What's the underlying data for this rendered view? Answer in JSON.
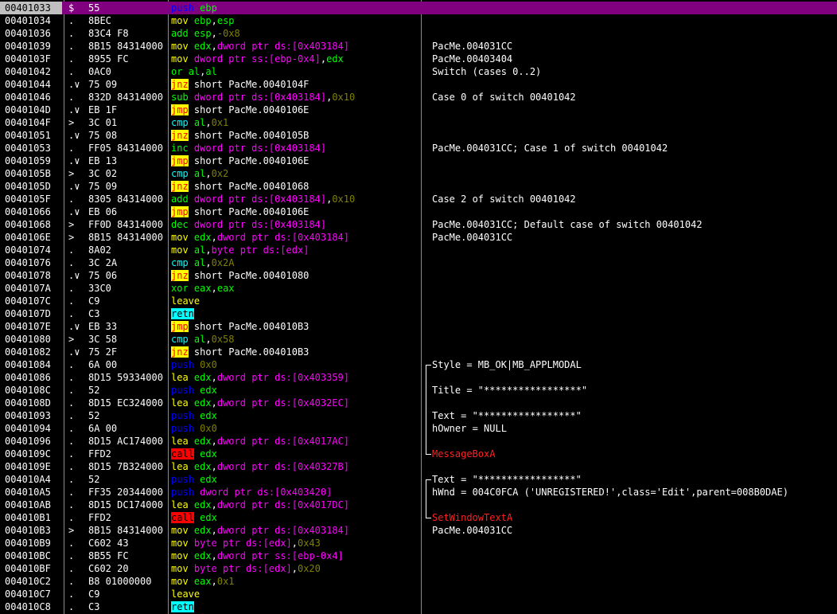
{
  "colors": {
    "background": "#000000",
    "selected_row": "#800080",
    "push_mnemonic": "#0000ff",
    "call_highlight": "#ff0000",
    "jump_highlight": "#ffff00",
    "ret_highlight": "#00ffff",
    "register": "#00ff00",
    "memory_operand": "#ff00ff",
    "immediate": "#808000",
    "api_name": "#ff2020"
  },
  "rows": [
    {
      "addr": "00401033",
      "mark": "$",
      "hex": "55",
      "asm": [
        {
          "t": "push",
          "c": "k-push"
        },
        {
          "t": " "
        },
        {
          "t": "ebp",
          "c": "o-reg"
        }
      ],
      "cmt": "",
      "selected": true
    },
    {
      "addr": "00401034",
      "mark": ".",
      "hex": "8BEC",
      "asm": [
        {
          "t": "mov",
          "c": "k-mov"
        },
        {
          "t": " "
        },
        {
          "t": "ebp",
          "c": "o-reg"
        },
        {
          "t": ","
        },
        {
          "t": "esp",
          "c": "o-reg"
        }
      ],
      "cmt": ""
    },
    {
      "addr": "00401036",
      "mark": ".",
      "hex": "83C4 F8",
      "asm": [
        {
          "t": "add",
          "c": "k-arith"
        },
        {
          "t": " "
        },
        {
          "t": "esp",
          "c": "o-reg"
        },
        {
          "t": ","
        },
        {
          "t": "-0x8",
          "c": "o-imm"
        }
      ],
      "cmt": ""
    },
    {
      "addr": "00401039",
      "mark": ".",
      "hex": "8B15 84314000",
      "asm": [
        {
          "t": "mov",
          "c": "k-mov"
        },
        {
          "t": " "
        },
        {
          "t": "edx",
          "c": "o-reg"
        },
        {
          "t": ","
        },
        {
          "t": "dword ptr ds:[0x403184]",
          "c": "o-mem"
        }
      ],
      "cmt": "PacMe.004031CC"
    },
    {
      "addr": "0040103F",
      "mark": ".",
      "hex": "8955 FC",
      "asm": [
        {
          "t": "mov",
          "c": "k-mov"
        },
        {
          "t": " "
        },
        {
          "t": "dword ptr ss:[ebp-0x4]",
          "c": "o-mem"
        },
        {
          "t": ","
        },
        {
          "t": "edx",
          "c": "o-reg"
        }
      ],
      "cmt": "PacMe.00403404"
    },
    {
      "addr": "00401042",
      "mark": ".",
      "hex": "0AC0",
      "asm": [
        {
          "t": "or",
          "c": "k-logic"
        },
        {
          "t": " "
        },
        {
          "t": "al",
          "c": "o-reg"
        },
        {
          "t": ","
        },
        {
          "t": "al",
          "c": "o-reg"
        }
      ],
      "cmt": "Switch (cases 0..2)"
    },
    {
      "addr": "00401044",
      "mark": ".∨",
      "hex": "75 09",
      "asm": [
        {
          "t": "jnz",
          "c": "k-jmp"
        },
        {
          "t": " short PacMe.0040104F",
          "c": "o-lbl"
        }
      ],
      "cmt": ""
    },
    {
      "addr": "00401046",
      "mark": ".",
      "hex": "832D 84314000",
      "asm": [
        {
          "t": "sub",
          "c": "k-arith"
        },
        {
          "t": " "
        },
        {
          "t": "dword ptr ds:[0x403184]",
          "c": "o-mem"
        },
        {
          "t": ","
        },
        {
          "t": "0x10",
          "c": "o-imm"
        }
      ],
      "cmt": "Case 0 of switch 00401042"
    },
    {
      "addr": "0040104D",
      "mark": ".∨",
      "hex": "EB 1F",
      "asm": [
        {
          "t": "jmp",
          "c": "k-jmp"
        },
        {
          "t": " short PacMe.0040106E",
          "c": "o-lbl"
        }
      ],
      "cmt": ""
    },
    {
      "addr": "0040104F",
      "mark": ">",
      "hex": "3C 01",
      "asm": [
        {
          "t": "cmp",
          "c": "k-cmp"
        },
        {
          "t": " "
        },
        {
          "t": "al",
          "c": "o-reg"
        },
        {
          "t": ","
        },
        {
          "t": "0x1",
          "c": "o-imm"
        }
      ],
      "cmt": ""
    },
    {
      "addr": "00401051",
      "mark": ".∨",
      "hex": "75 08",
      "asm": [
        {
          "t": "jnz",
          "c": "k-jmp"
        },
        {
          "t": " short PacMe.0040105B",
          "c": "o-lbl"
        }
      ],
      "cmt": ""
    },
    {
      "addr": "00401053",
      "mark": ".",
      "hex": "FF05 84314000",
      "asm": [
        {
          "t": "inc",
          "c": "k-arith"
        },
        {
          "t": " "
        },
        {
          "t": "dword ptr ds:[0x403184]",
          "c": "o-mem"
        }
      ],
      "cmt": "PacMe.004031CC; Case 1 of switch 00401042"
    },
    {
      "addr": "00401059",
      "mark": ".∨",
      "hex": "EB 13",
      "asm": [
        {
          "t": "jmp",
          "c": "k-jmp"
        },
        {
          "t": " short PacMe.0040106E",
          "c": "o-lbl"
        }
      ],
      "cmt": ""
    },
    {
      "addr": "0040105B",
      "mark": ">",
      "hex": "3C 02",
      "asm": [
        {
          "t": "cmp",
          "c": "k-cmp"
        },
        {
          "t": " "
        },
        {
          "t": "al",
          "c": "o-reg"
        },
        {
          "t": ","
        },
        {
          "t": "0x2",
          "c": "o-imm"
        }
      ],
      "cmt": ""
    },
    {
      "addr": "0040105D",
      "mark": ".∨",
      "hex": "75 09",
      "asm": [
        {
          "t": "jnz",
          "c": "k-jmp"
        },
        {
          "t": " short PacMe.00401068",
          "c": "o-lbl"
        }
      ],
      "cmt": ""
    },
    {
      "addr": "0040105F",
      "mark": ".",
      "hex": "8305 84314000",
      "asm": [
        {
          "t": "add",
          "c": "k-arith"
        },
        {
          "t": " "
        },
        {
          "t": "dword ptr ds:[0x403184]",
          "c": "o-mem"
        },
        {
          "t": ","
        },
        {
          "t": "0x10",
          "c": "o-imm"
        }
      ],
      "cmt": "Case 2 of switch 00401042"
    },
    {
      "addr": "00401066",
      "mark": ".∨",
      "hex": "EB 06",
      "asm": [
        {
          "t": "jmp",
          "c": "k-jmp"
        },
        {
          "t": " short PacMe.0040106E",
          "c": "o-lbl"
        }
      ],
      "cmt": ""
    },
    {
      "addr": "00401068",
      "mark": ">",
      "hex": "FF0D 84314000",
      "asm": [
        {
          "t": "dec",
          "c": "k-arith"
        },
        {
          "t": " "
        },
        {
          "t": "dword ptr ds:[0x403184]",
          "c": "o-mem"
        }
      ],
      "cmt": "PacMe.004031CC; Default case of switch 00401042"
    },
    {
      "addr": "0040106E",
      "mark": ">",
      "hex": "8B15 84314000",
      "asm": [
        {
          "t": "mov",
          "c": "k-mov"
        },
        {
          "t": " "
        },
        {
          "t": "edx",
          "c": "o-reg"
        },
        {
          "t": ","
        },
        {
          "t": "dword ptr ds:[0x403184]",
          "c": "o-mem"
        }
      ],
      "cmt": "PacMe.004031CC"
    },
    {
      "addr": "00401074",
      "mark": ".",
      "hex": "8A02",
      "asm": [
        {
          "t": "mov",
          "c": "k-mov"
        },
        {
          "t": " "
        },
        {
          "t": "al",
          "c": "o-reg"
        },
        {
          "t": ","
        },
        {
          "t": "byte ptr ds:[edx]",
          "c": "o-mem"
        }
      ],
      "cmt": ""
    },
    {
      "addr": "00401076",
      "mark": ".",
      "hex": "3C 2A",
      "asm": [
        {
          "t": "cmp",
          "c": "k-cmp"
        },
        {
          "t": " "
        },
        {
          "t": "al",
          "c": "o-reg"
        },
        {
          "t": ","
        },
        {
          "t": "0x2A",
          "c": "o-imm"
        }
      ],
      "cmt": ""
    },
    {
      "addr": "00401078",
      "mark": ".∨",
      "hex": "75 06",
      "asm": [
        {
          "t": "jnz",
          "c": "k-jmp"
        },
        {
          "t": " short PacMe.00401080",
          "c": "o-lbl"
        }
      ],
      "cmt": ""
    },
    {
      "addr": "0040107A",
      "mark": ".",
      "hex": "33C0",
      "asm": [
        {
          "t": "xor",
          "c": "k-logic"
        },
        {
          "t": " "
        },
        {
          "t": "eax",
          "c": "o-reg"
        },
        {
          "t": ","
        },
        {
          "t": "eax",
          "c": "o-reg"
        }
      ],
      "cmt": ""
    },
    {
      "addr": "0040107C",
      "mark": ".",
      "hex": "C9",
      "asm": [
        {
          "t": "leave",
          "c": "k-leave"
        }
      ],
      "cmt": ""
    },
    {
      "addr": "0040107D",
      "mark": ".",
      "hex": "C3",
      "asm": [
        {
          "t": "retn",
          "c": "k-ret"
        }
      ],
      "cmt": ""
    },
    {
      "addr": "0040107E",
      "mark": ".∨",
      "hex": "EB 33",
      "asm": [
        {
          "t": "jmp",
          "c": "k-jmp"
        },
        {
          "t": " short PacMe.004010B3",
          "c": "o-lbl"
        }
      ],
      "cmt": ""
    },
    {
      "addr": "00401080",
      "mark": ">",
      "hex": "3C 58",
      "asm": [
        {
          "t": "cmp",
          "c": "k-cmp"
        },
        {
          "t": " "
        },
        {
          "t": "al",
          "c": "o-reg"
        },
        {
          "t": ","
        },
        {
          "t": "0x58",
          "c": "o-imm"
        }
      ],
      "cmt": ""
    },
    {
      "addr": "00401082",
      "mark": ".∨",
      "hex": "75 2F",
      "asm": [
        {
          "t": "jnz",
          "c": "k-jmp"
        },
        {
          "t": " short PacMe.004010B3",
          "c": "o-lbl"
        }
      ],
      "cmt": ""
    },
    {
      "addr": "00401084",
      "mark": ".",
      "hex": "6A 00",
      "asm": [
        {
          "t": "push",
          "c": "k-push"
        },
        {
          "t": " "
        },
        {
          "t": "0x0",
          "c": "o-imm"
        }
      ],
      "cmt": "Style = MB_OK|MB_APPLMODAL"
    },
    {
      "addr": "00401086",
      "mark": ".",
      "hex": "8D15 59334000",
      "asm": [
        {
          "t": "lea",
          "c": "k-mov"
        },
        {
          "t": " "
        },
        {
          "t": "edx",
          "c": "o-reg"
        },
        {
          "t": ","
        },
        {
          "t": "dword ptr ds:[0x403359]",
          "c": "o-mem"
        }
      ],
      "cmt": ""
    },
    {
      "addr": "0040108C",
      "mark": ".",
      "hex": "52",
      "asm": [
        {
          "t": "push",
          "c": "k-push"
        },
        {
          "t": " "
        },
        {
          "t": "edx",
          "c": "o-reg"
        }
      ],
      "cmt": "Title = \"*****************\""
    },
    {
      "addr": "0040108D",
      "mark": ".",
      "hex": "8D15 EC324000",
      "asm": [
        {
          "t": "lea",
          "c": "k-mov"
        },
        {
          "t": " "
        },
        {
          "t": "edx",
          "c": "o-reg"
        },
        {
          "t": ","
        },
        {
          "t": "dword ptr ds:[0x4032EC]",
          "c": "o-mem"
        }
      ],
      "cmt": ""
    },
    {
      "addr": "00401093",
      "mark": ".",
      "hex": "52",
      "asm": [
        {
          "t": "push",
          "c": "k-push"
        },
        {
          "t": " "
        },
        {
          "t": "edx",
          "c": "o-reg"
        }
      ],
      "cmt": "Text = \"*****************\""
    },
    {
      "addr": "00401094",
      "mark": ".",
      "hex": "6A 00",
      "asm": [
        {
          "t": "push",
          "c": "k-push"
        },
        {
          "t": " "
        },
        {
          "t": "0x0",
          "c": "o-imm"
        }
      ],
      "cmt": "hOwner = NULL"
    },
    {
      "addr": "00401096",
      "mark": ".",
      "hex": "8D15 AC174000",
      "asm": [
        {
          "t": "lea",
          "c": "k-mov"
        },
        {
          "t": " "
        },
        {
          "t": "edx",
          "c": "o-reg"
        },
        {
          "t": ","
        },
        {
          "t": "dword ptr ds:[0x4017AC]",
          "c": "o-mem"
        }
      ],
      "cmt": ""
    },
    {
      "addr": "0040109C",
      "mark": ".",
      "hex": "FFD2",
      "asm": [
        {
          "t": "call",
          "c": "k-call"
        },
        {
          "t": " "
        },
        {
          "t": "edx",
          "c": "o-reg"
        }
      ],
      "cmt": "MessageBoxA",
      "cmt_class": "cm-red"
    },
    {
      "addr": "0040109E",
      "mark": ".",
      "hex": "8D15 7B324000",
      "asm": [
        {
          "t": "lea",
          "c": "k-mov"
        },
        {
          "t": " "
        },
        {
          "t": "edx",
          "c": "o-reg"
        },
        {
          "t": ","
        },
        {
          "t": "dword ptr ds:[0x40327B]",
          "c": "o-mem"
        }
      ],
      "cmt": ""
    },
    {
      "addr": "004010A4",
      "mark": ".",
      "hex": "52",
      "asm": [
        {
          "t": "push",
          "c": "k-push"
        },
        {
          "t": " "
        },
        {
          "t": "edx",
          "c": "o-reg"
        }
      ],
      "cmt": "Text = \"*****************\""
    },
    {
      "addr": "004010A5",
      "mark": ".",
      "hex": "FF35 20344000",
      "asm": [
        {
          "t": "push",
          "c": "k-push"
        },
        {
          "t": " "
        },
        {
          "t": "dword ptr ds:[0x403420]",
          "c": "o-mem"
        }
      ],
      "cmt": "hWnd = 004C0FCA ('UNREGISTERED!',class='Edit',parent=008B0DAE)"
    },
    {
      "addr": "004010AB",
      "mark": ".",
      "hex": "8D15 DC174000",
      "asm": [
        {
          "t": "lea",
          "c": "k-mov"
        },
        {
          "t": " "
        },
        {
          "t": "edx",
          "c": "o-reg"
        },
        {
          "t": ","
        },
        {
          "t": "dword ptr ds:[0x4017DC]",
          "c": "o-mem"
        }
      ],
      "cmt": ""
    },
    {
      "addr": "004010B1",
      "mark": ".",
      "hex": "FFD2",
      "asm": [
        {
          "t": "call",
          "c": "k-call"
        },
        {
          "t": " "
        },
        {
          "t": "edx",
          "c": "o-reg"
        }
      ],
      "cmt": "SetWindowTextA",
      "cmt_class": "cm-red"
    },
    {
      "addr": "004010B3",
      "mark": ">",
      "hex": "8B15 84314000",
      "asm": [
        {
          "t": "mov",
          "c": "k-mov"
        },
        {
          "t": " "
        },
        {
          "t": "edx",
          "c": "o-reg"
        },
        {
          "t": ","
        },
        {
          "t": "dword ptr ds:[0x403184]",
          "c": "o-mem"
        }
      ],
      "cmt": "PacMe.004031CC"
    },
    {
      "addr": "004010B9",
      "mark": ".",
      "hex": "C602 43",
      "asm": [
        {
          "t": "mov",
          "c": "k-mov"
        },
        {
          "t": " "
        },
        {
          "t": "byte ptr ds:[edx]",
          "c": "o-mem"
        },
        {
          "t": ","
        },
        {
          "t": "0x43",
          "c": "o-imm"
        }
      ],
      "cmt": ""
    },
    {
      "addr": "004010BC",
      "mark": ".",
      "hex": "8B55 FC",
      "asm": [
        {
          "t": "mov",
          "c": "k-mov"
        },
        {
          "t": " "
        },
        {
          "t": "edx",
          "c": "o-reg"
        },
        {
          "t": ","
        },
        {
          "t": "dword ptr ss:[ebp-0x4]",
          "c": "o-mem"
        }
      ],
      "cmt": ""
    },
    {
      "addr": "004010BF",
      "mark": ".",
      "hex": "C602 20",
      "asm": [
        {
          "t": "mov",
          "c": "k-mov"
        },
        {
          "t": " "
        },
        {
          "t": "byte ptr ds:[edx]",
          "c": "o-mem"
        },
        {
          "t": ","
        },
        {
          "t": "0x20",
          "c": "o-imm"
        }
      ],
      "cmt": ""
    },
    {
      "addr": "004010C2",
      "mark": ".",
      "hex": "B8 01000000",
      "asm": [
        {
          "t": "mov",
          "c": "k-mov"
        },
        {
          "t": " "
        },
        {
          "t": "eax",
          "c": "o-reg"
        },
        {
          "t": ","
        },
        {
          "t": "0x1",
          "c": "o-imm"
        }
      ],
      "cmt": ""
    },
    {
      "addr": "004010C7",
      "mark": ".",
      "hex": "C9",
      "asm": [
        {
          "t": "leave",
          "c": "k-leave"
        }
      ],
      "cmt": ""
    },
    {
      "addr": "004010C8",
      "mark": ".",
      "hex": "C3",
      "asm": [
        {
          "t": "retn",
          "c": "k-ret"
        }
      ],
      "cmt": ""
    }
  ]
}
